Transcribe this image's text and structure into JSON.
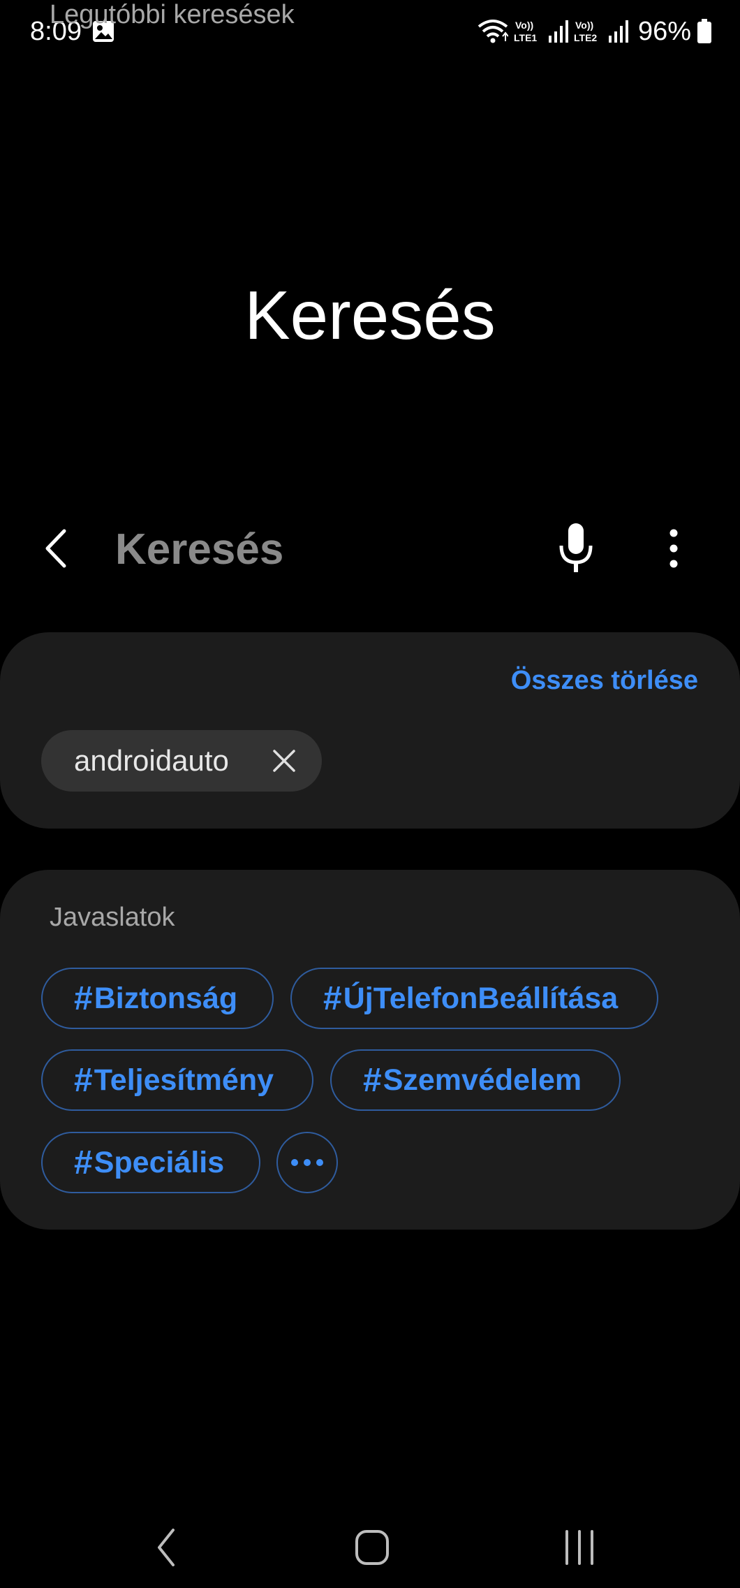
{
  "status_bar": {
    "time": "8:09",
    "battery_percent": "96%",
    "sim1_label": "Vo)) LTE1",
    "sim2_label": "Vo)) LTE2",
    "icons": [
      "gallery-icon",
      "wifi-icon",
      "signal-icon",
      "battery-icon"
    ]
  },
  "page_title": "Keresés",
  "search": {
    "placeholder": "Keresés",
    "value": ""
  },
  "recent": {
    "heading": "Legutóbbi keresések",
    "clear_all_label": "Összes törlése",
    "items": [
      {
        "label": "androidauto"
      }
    ]
  },
  "suggestions": {
    "heading": "Javaslatok",
    "tags": [
      {
        "label": "Biztonság"
      },
      {
        "label": "ÚjTelefonBeállítása"
      },
      {
        "label": "Teljesítmény"
      },
      {
        "label": "Szemvédelem"
      },
      {
        "label": "Speciális"
      }
    ],
    "hash_symbol": "#"
  },
  "colors": {
    "accent": "#3e8ef7",
    "card_background": "#1c1c1c",
    "chip_background": "#333333",
    "tag_border": "#2f5c9e"
  }
}
